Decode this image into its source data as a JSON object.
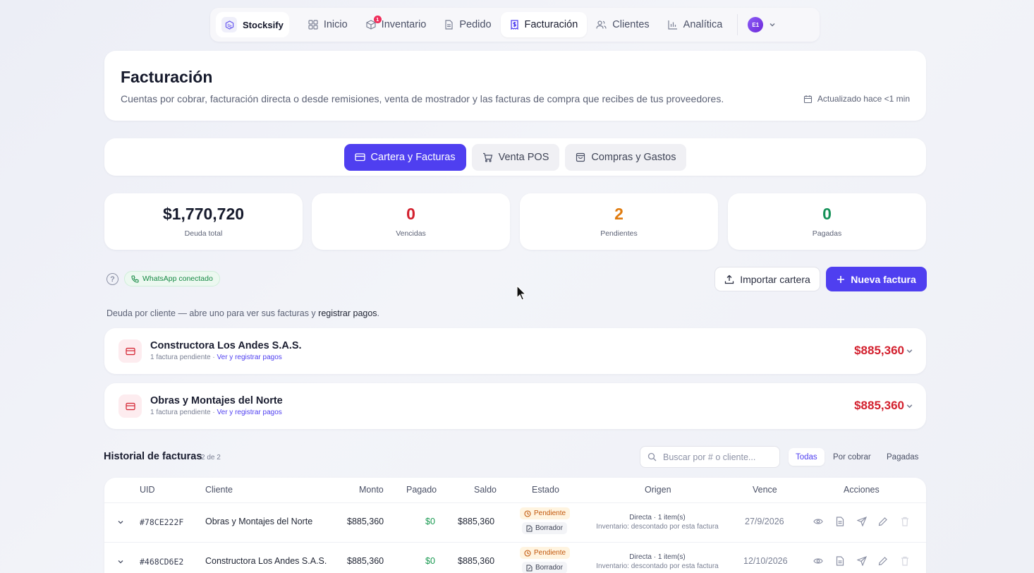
{
  "nav": {
    "brand": "Stocksify",
    "items": [
      {
        "label": "Inicio",
        "icon": "grid-icon"
      },
      {
        "label": "Inventario",
        "icon": "box-icon",
        "badge": "1"
      },
      {
        "label": "Pedido",
        "icon": "document-icon"
      },
      {
        "label": "Facturación",
        "icon": "invoice-icon",
        "active": true
      },
      {
        "label": "Clientes",
        "icon": "users-icon"
      },
      {
        "label": "Analítica",
        "icon": "bar-chart-icon"
      }
    ],
    "avatar": "E1"
  },
  "header": {
    "title": "Facturación",
    "description": "Cuentas por cobrar, facturación directa o desde remisiones, venta de mostrador y las facturas de compra que recibes de tus proveedores.",
    "updated": "Actualizado hace <1 min"
  },
  "tabs": [
    {
      "label": "Cartera y Facturas",
      "active": true
    },
    {
      "label": "Venta POS"
    },
    {
      "label": "Compras y Gastos"
    }
  ],
  "stats": [
    {
      "value": "$1,770,720",
      "label": "Deuda total",
      "color": "#161a2c"
    },
    {
      "value": "0",
      "label": "Vencidas",
      "color": "#d3202e"
    },
    {
      "value": "2",
      "label": "Pendientes",
      "color": "#e07b0e"
    },
    {
      "value": "0",
      "label": "Pagadas",
      "color": "#149158"
    }
  ],
  "actions": {
    "whatsapp": "WhatsApp conectado",
    "import": "Importar cartera",
    "new_invoice": "Nueva factura"
  },
  "debt": {
    "intro": "Deuda por cliente — abre uno para ver sus facturas y ",
    "intro_bold": "registrar pagos",
    "intro_end": ".",
    "clients": [
      {
        "name": "Constructora Los Andes S.A.S.",
        "sub": "1 factura pendiente · ",
        "link": "Ver y registrar pagos",
        "amount": "$885,360"
      },
      {
        "name": "Obras y Montajes del Norte",
        "sub": "1 factura pendiente · ",
        "link": "Ver y registrar pagos",
        "amount": "$885,360"
      }
    ]
  },
  "history": {
    "title": "Historial de facturas",
    "count": "2 de 2",
    "search_placeholder": "Buscar por # o cliente...",
    "filters": [
      "Todas",
      "Por cobrar",
      "Pagadas"
    ],
    "columns": [
      "UID",
      "Cliente",
      "Monto",
      "Pagado",
      "Saldo",
      "Estado",
      "Origen",
      "Vence",
      "Acciones"
    ],
    "rows": [
      {
        "uid": "#78CE222F",
        "client": "Obras y Montajes del Norte",
        "amount": "$885,360",
        "paid": "$0",
        "balance": "$885,360",
        "status": "Pendiente",
        "draft": "Borrador",
        "origin": "Directa · 1 item(s)",
        "origin_sub": "Inventario: descontado por esta factura",
        "due": "27/9/2026"
      },
      {
        "uid": "#468CD6E2",
        "client": "Constructora Los Andes S.A.S.",
        "amount": "$885,360",
        "paid": "$0",
        "balance": "$885,360",
        "status": "Pendiente",
        "draft": "Borrador",
        "origin": "Directa · 1 item(s)",
        "origin_sub": "Inventario: descontado por esta factura",
        "due": "12/10/2026"
      }
    ]
  }
}
